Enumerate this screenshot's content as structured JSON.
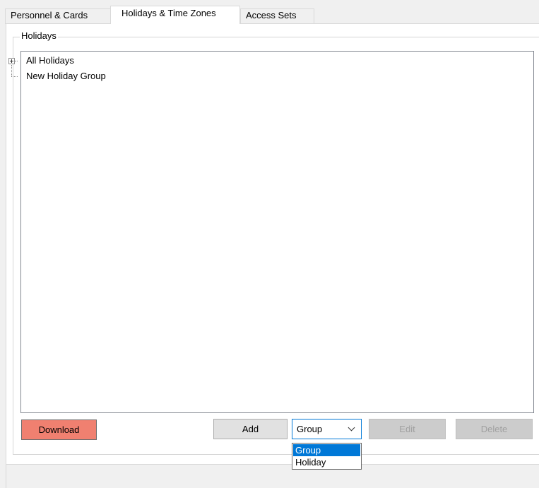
{
  "tabs": [
    {
      "label": "Personnel & Cards",
      "active": false
    },
    {
      "label": "Holidays & Time Zones",
      "active": true
    },
    {
      "label": "Access Sets",
      "active": false
    }
  ],
  "holidays_group": {
    "legend": "Holidays",
    "tree": [
      {
        "label": "All Holidays",
        "expandable": true
      },
      {
        "label": "New Holiday Group",
        "expandable": false
      }
    ]
  },
  "buttons": {
    "download": "Download",
    "add": "Add",
    "edit": "Edit",
    "delete": "Delete"
  },
  "type_select": {
    "value": "Group",
    "options": [
      "Group",
      "Holiday"
    ],
    "highlighted": "Group"
  },
  "colors": {
    "download_button": "#f08070",
    "selection": "#0078d7"
  }
}
